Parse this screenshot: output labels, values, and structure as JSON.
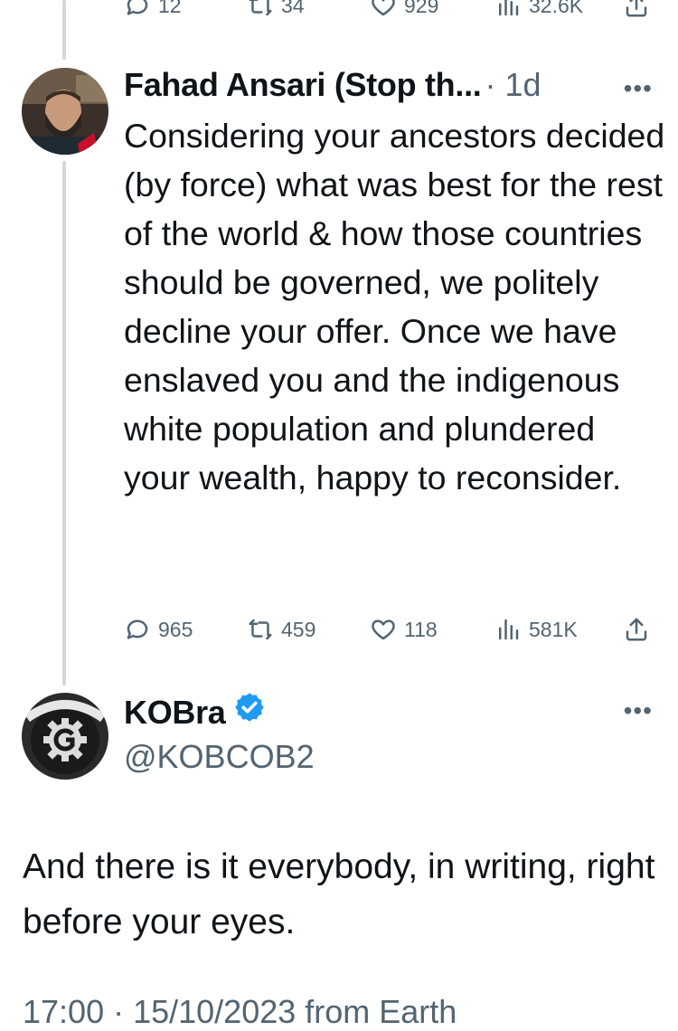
{
  "top_actions": {
    "reply_count": "12",
    "retweet_count": "34",
    "like_count": "929",
    "view_count": "32.6K"
  },
  "reply_tweet": {
    "author_name": "Fahad Ansari (Stop th...",
    "time": "· 1d",
    "more_label": "•••",
    "text": "Considering your ancestors decided (by force) what was best for the rest of the world & how those countries should be governed, we politely decline your offer. Once we have enslaved you and the indigenous white population and plundered your wealth, happy to reconsider.",
    "reply_count": "965",
    "retweet_count": "459",
    "like_count": "118",
    "view_count": "581K"
  },
  "main_tweet": {
    "author_name": "KOBra",
    "handle": "@KOBCOB2",
    "more_label": "•••",
    "text": "And there is it everybody, in writing, right before your eyes.",
    "footer_partial": "17:00 · 15/10/2023 from Earth"
  },
  "colors": {
    "text": "#0f1419",
    "secondary": "#536471",
    "thread_line": "#cfd9de",
    "verified_blue": "#1d9bf0"
  }
}
